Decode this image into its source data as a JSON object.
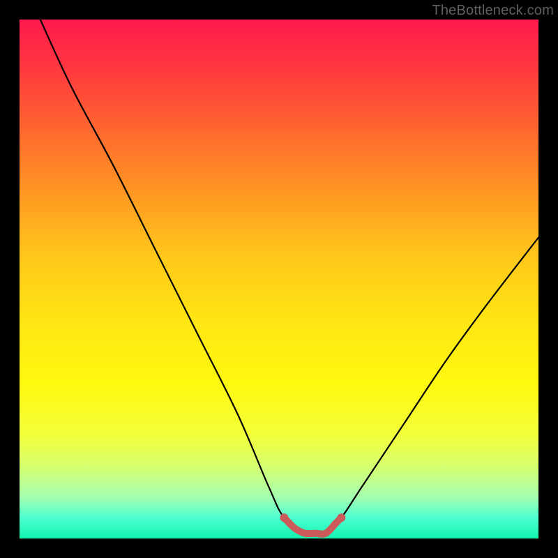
{
  "watermark": "TheBottleneck.com",
  "chart_data": {
    "type": "line",
    "title": "",
    "xlabel": "",
    "ylabel": "",
    "xlim": [
      0,
      100
    ],
    "ylim": [
      0,
      100
    ],
    "series": [
      {
        "name": "curve",
        "x": [
          4,
          10,
          18,
          26,
          34,
          42,
          48,
          51,
          55,
          59,
          62,
          66,
          74,
          82,
          90,
          100
        ],
        "y": [
          100,
          87,
          72,
          56,
          40,
          24,
          10,
          4,
          1,
          1,
          4,
          10,
          22,
          34,
          45,
          58
        ]
      },
      {
        "name": "flat-segment",
        "x": [
          51,
          53,
          55,
          57,
          59,
          61,
          62
        ],
        "y": [
          4,
          2,
          1,
          1,
          1,
          3,
          4
        ]
      }
    ],
    "colors": {
      "curve": "#000000",
      "flat_segment": "#cc5a5a"
    }
  }
}
